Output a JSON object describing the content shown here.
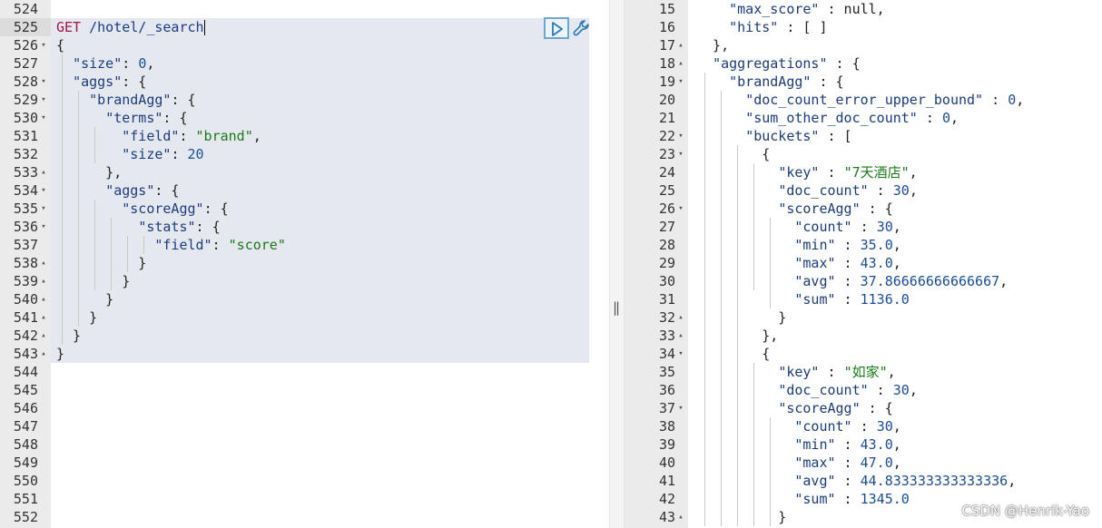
{
  "left_editor": {
    "request_method": "GET",
    "request_path": "/hotel/_search",
    "lines": [
      {
        "num": "524",
        "fold": "",
        "content": ""
      },
      {
        "num": "525",
        "fold": "",
        "content": "request"
      },
      {
        "num": "526",
        "fold": "down",
        "text": "{"
      },
      {
        "num": "527",
        "fold": "",
        "text": "  \"size\": 0,"
      },
      {
        "num": "528",
        "fold": "down",
        "text": "  \"aggs\": {"
      },
      {
        "num": "529",
        "fold": "down",
        "text": "    \"brandAgg\": {"
      },
      {
        "num": "530",
        "fold": "down",
        "text": "      \"terms\": {"
      },
      {
        "num": "531",
        "fold": "",
        "text": "        \"field\": \"brand\","
      },
      {
        "num": "532",
        "fold": "",
        "text": "        \"size\": 20"
      },
      {
        "num": "533",
        "fold": "up",
        "text": "      },"
      },
      {
        "num": "534",
        "fold": "down",
        "text": "      \"aggs\": {"
      },
      {
        "num": "535",
        "fold": "down",
        "text": "        \"scoreAgg\": {"
      },
      {
        "num": "536",
        "fold": "down",
        "text": "          \"stats\": {"
      },
      {
        "num": "537",
        "fold": "",
        "text": "            \"field\": \"score\""
      },
      {
        "num": "538",
        "fold": "up",
        "text": "          }"
      },
      {
        "num": "539",
        "fold": "up",
        "text": "        }"
      },
      {
        "num": "540",
        "fold": "up",
        "text": "      }"
      },
      {
        "num": "541",
        "fold": "up",
        "text": "    }"
      },
      {
        "num": "542",
        "fold": "up",
        "text": "  }"
      },
      {
        "num": "543",
        "fold": "up",
        "text": "}"
      },
      {
        "num": "544",
        "fold": "",
        "text": ""
      },
      {
        "num": "545",
        "fold": "",
        "text": ""
      },
      {
        "num": "546",
        "fold": "",
        "text": ""
      },
      {
        "num": "547",
        "fold": "",
        "text": ""
      },
      {
        "num": "548",
        "fold": "",
        "text": ""
      },
      {
        "num": "549",
        "fold": "",
        "text": ""
      },
      {
        "num": "550",
        "fold": "",
        "text": ""
      },
      {
        "num": "551",
        "fold": "",
        "text": ""
      },
      {
        "num": "552",
        "fold": "",
        "text": ""
      }
    ]
  },
  "right_viewer": {
    "lines": [
      {
        "num": "15",
        "fold": "",
        "text": "    \"max_score\" : null,"
      },
      {
        "num": "16",
        "fold": "",
        "text": "    \"hits\" : [ ]"
      },
      {
        "num": "17",
        "fold": "up",
        "text": "  },"
      },
      {
        "num": "18",
        "fold": "up",
        "text": "  \"aggregations\" : {"
      },
      {
        "num": "19",
        "fold": "down",
        "text": "    \"brandAgg\" : {"
      },
      {
        "num": "20",
        "fold": "",
        "text": "      \"doc_count_error_upper_bound\" : 0,"
      },
      {
        "num": "21",
        "fold": "",
        "text": "      \"sum_other_doc_count\" : 0,"
      },
      {
        "num": "22",
        "fold": "down",
        "text": "      \"buckets\" : ["
      },
      {
        "num": "23",
        "fold": "down",
        "text": "        {"
      },
      {
        "num": "24",
        "fold": "",
        "text": "          \"key\" : \"7天酒店\","
      },
      {
        "num": "25",
        "fold": "",
        "text": "          \"doc_count\" : 30,"
      },
      {
        "num": "26",
        "fold": "down",
        "text": "          \"scoreAgg\" : {"
      },
      {
        "num": "27",
        "fold": "",
        "text": "            \"count\" : 30,"
      },
      {
        "num": "28",
        "fold": "",
        "text": "            \"min\" : 35.0,"
      },
      {
        "num": "29",
        "fold": "",
        "text": "            \"max\" : 43.0,"
      },
      {
        "num": "30",
        "fold": "",
        "text": "            \"avg\" : 37.86666666666667,"
      },
      {
        "num": "31",
        "fold": "",
        "text": "            \"sum\" : 1136.0"
      },
      {
        "num": "32",
        "fold": "up",
        "text": "          }"
      },
      {
        "num": "33",
        "fold": "up",
        "text": "        },"
      },
      {
        "num": "34",
        "fold": "down",
        "text": "        {"
      },
      {
        "num": "35",
        "fold": "",
        "text": "          \"key\" : \"如家\","
      },
      {
        "num": "36",
        "fold": "",
        "text": "          \"doc_count\" : 30,"
      },
      {
        "num": "37",
        "fold": "down",
        "text": "          \"scoreAgg\" : {"
      },
      {
        "num": "38",
        "fold": "",
        "text": "            \"count\" : 30,"
      },
      {
        "num": "39",
        "fold": "",
        "text": "            \"min\" : 43.0,"
      },
      {
        "num": "40",
        "fold": "",
        "text": "            \"max\" : 47.0,"
      },
      {
        "num": "41",
        "fold": "",
        "text": "            \"avg\" : 44.833333333333336,"
      },
      {
        "num": "42",
        "fold": "",
        "text": "            \"sum\" : 1345.0"
      },
      {
        "num": "43",
        "fold": "up",
        "text": "          }"
      }
    ]
  },
  "toolbar": {
    "run_icon": "play-icon",
    "settings_icon": "wrench-icon"
  },
  "divider": {
    "handle": "||"
  },
  "watermark": "CSDN @Henrik-Yao",
  "colors": {
    "method": "#a0164a",
    "string": "#1a7a1a",
    "number": "#1c4d9c",
    "key": "#1c3c7c",
    "selection": "#e6e8ef",
    "gutter": "#ebebeb"
  }
}
